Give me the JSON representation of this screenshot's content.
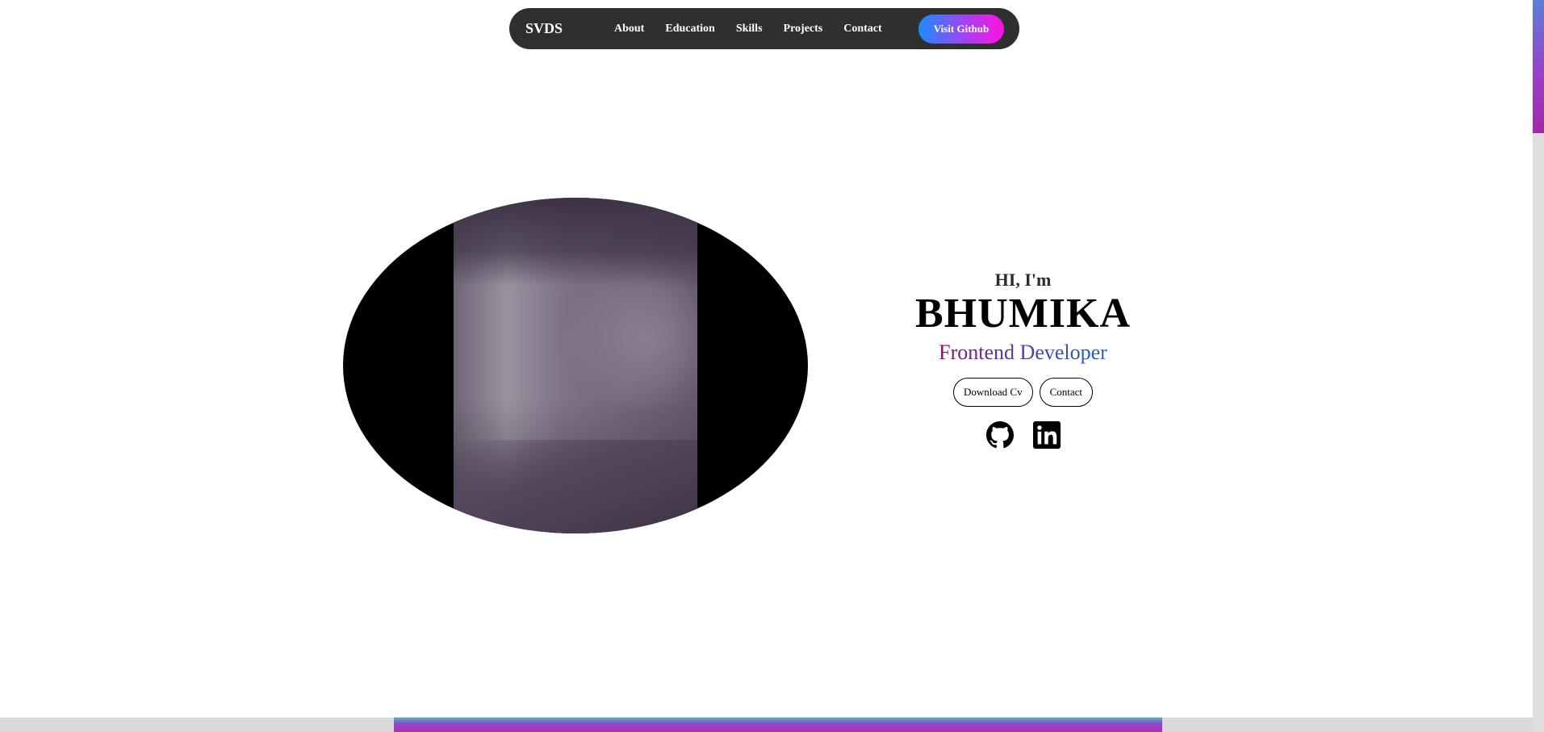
{
  "navbar": {
    "brand": "SVDS",
    "links": [
      {
        "label": "About"
      },
      {
        "label": "Education"
      },
      {
        "label": "Skills"
      },
      {
        "label": "Projects"
      },
      {
        "label": "Contact"
      }
    ],
    "github_button": "Visit Github"
  },
  "hero": {
    "greeting": "HI, I'm",
    "name": "BHUMIKA",
    "role": "Frontend Developer",
    "buttons": {
      "download": "Download Cv",
      "contact": "Contact"
    },
    "socials": [
      {
        "icon": "github-icon"
      },
      {
        "icon": "linkedin-icon"
      }
    ]
  },
  "colors": {
    "navbar_bg": "#2f2f2f",
    "github_gradient_start": "#1a8cff",
    "github_gradient_end": "#ff10e0",
    "role_gradient_start": "#8a1070",
    "role_gradient_end": "#1f63c0"
  }
}
